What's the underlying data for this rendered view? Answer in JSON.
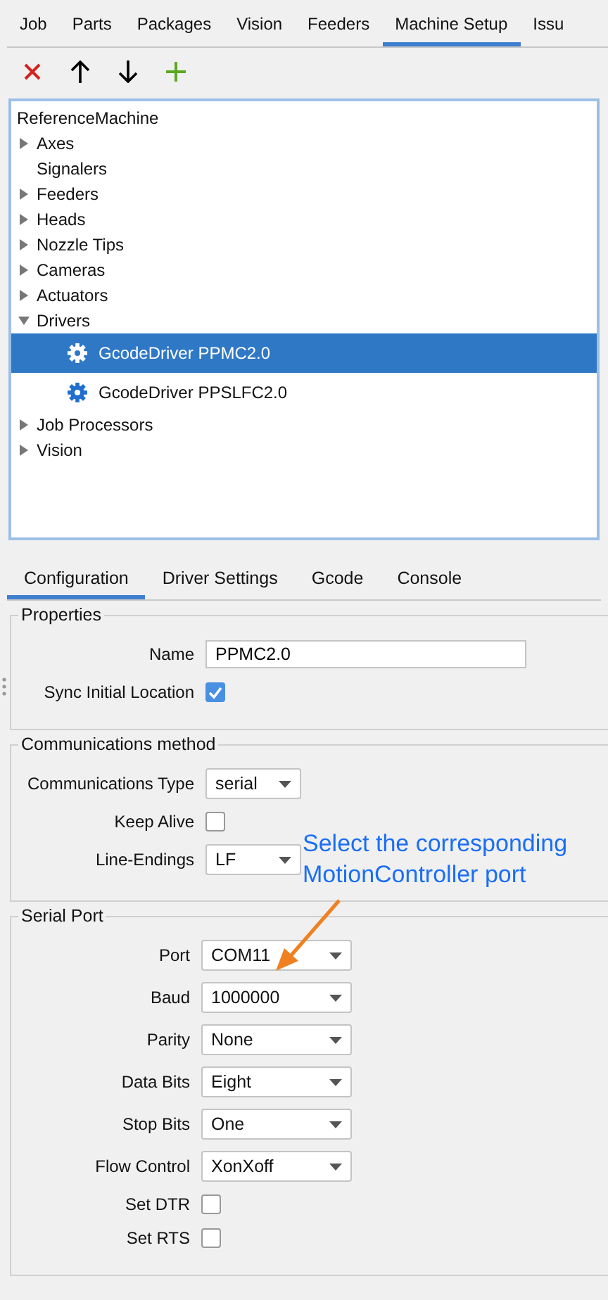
{
  "tabs": [
    {
      "label": "Job",
      "selected": false
    },
    {
      "label": "Parts",
      "selected": false
    },
    {
      "label": "Packages",
      "selected": false
    },
    {
      "label": "Vision",
      "selected": false
    },
    {
      "label": "Feeders",
      "selected": false
    },
    {
      "label": "Machine Setup",
      "selected": true
    },
    {
      "label": "Issu",
      "selected": false
    }
  ],
  "toolbar": [
    {
      "kind": "delete"
    },
    {
      "kind": "up"
    },
    {
      "kind": "down"
    },
    {
      "kind": "add"
    }
  ],
  "tree": {
    "root": "ReferenceMachine",
    "items": [
      {
        "label": "Axes",
        "kind": "folder",
        "expanded": false
      },
      {
        "label": "Signalers",
        "kind": "leaf"
      },
      {
        "label": "Feeders",
        "kind": "folder",
        "expanded": false
      },
      {
        "label": "Heads",
        "kind": "folder",
        "expanded": false
      },
      {
        "label": "Nozzle Tips",
        "kind": "folder",
        "expanded": false
      },
      {
        "label": "Cameras",
        "kind": "folder",
        "expanded": false
      },
      {
        "label": "Actuators",
        "kind": "folder",
        "expanded": false
      },
      {
        "label": "Drivers",
        "kind": "folder",
        "expanded": true,
        "children": [
          {
            "label": "GcodeDriver PPMC2.0",
            "selected": true
          },
          {
            "label": "GcodeDriver PPSLFC2.0",
            "selected": false
          }
        ]
      },
      {
        "label": "Job Processors",
        "kind": "folder",
        "expanded": false
      },
      {
        "label": "Vision",
        "kind": "folder",
        "expanded": false
      }
    ]
  },
  "sub_tabs": [
    {
      "label": "Configuration",
      "selected": true
    },
    {
      "label": "Driver Settings",
      "selected": false
    },
    {
      "label": "Gcode",
      "selected": false
    },
    {
      "label": "Console",
      "selected": false
    }
  ],
  "groups": [
    {
      "title": "Properties",
      "rows": [
        {
          "kind": "text",
          "label": "Name",
          "value": "PPMC2.0"
        },
        {
          "kind": "checkbox",
          "label": "Sync Initial Location",
          "checked": true
        }
      ]
    },
    {
      "title": "Communications method",
      "rows": [
        {
          "kind": "select",
          "label": "Communications Type",
          "value": "serial"
        },
        {
          "kind": "checkbox",
          "label": "Keep Alive",
          "checked": false
        },
        {
          "kind": "select",
          "label": "Line-Endings",
          "value": "LF"
        }
      ]
    },
    {
      "title": "Serial Port",
      "rows": [
        {
          "kind": "select",
          "label": "Port",
          "value": "COM11"
        },
        {
          "kind": "select",
          "label": "Baud",
          "value": "1000000"
        },
        {
          "kind": "select",
          "label": "Parity",
          "value": "None"
        },
        {
          "kind": "select",
          "label": "Data Bits",
          "value": "Eight"
        },
        {
          "kind": "select",
          "label": "Stop Bits",
          "value": "One"
        },
        {
          "kind": "select",
          "label": "Flow Control",
          "value": "XonXoff"
        },
        {
          "kind": "checkbox",
          "label": "Set DTR",
          "checked": false
        },
        {
          "kind": "checkbox",
          "label": "Set RTS",
          "checked": false
        }
      ]
    }
  ],
  "annotation": {
    "lines": [
      "Select the corresponding",
      "MotionController port"
    ]
  }
}
